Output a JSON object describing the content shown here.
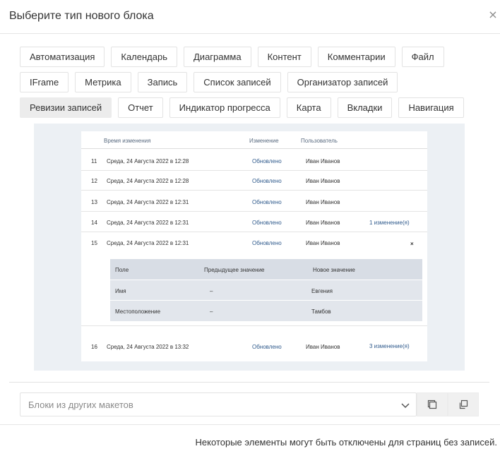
{
  "dialog": {
    "title": "Выберите тип нового блока",
    "close_glyph": "×"
  },
  "block_types": {
    "row1": [
      "Автоматизация",
      "Календарь",
      "Диаграмма",
      "Контент",
      "Комментарии",
      "Файл"
    ],
    "row2": [
      "IFrame",
      "Метрика",
      "Запись",
      "Список записей",
      "Организатор записей"
    ],
    "row3": [
      "Ревизии записей",
      "Отчет",
      "Индикатор прогресса",
      "Карта",
      "Вкладки",
      "Навигация"
    ],
    "selected": "Ревизии записей"
  },
  "preview": {
    "columns": {
      "time": "Время изменения",
      "change": "Изменение",
      "user": "Пользователь"
    },
    "rows": [
      {
        "num": "11",
        "date": "Среда, 24 Августа 2022 в 12:28",
        "change": "Обновлено",
        "user": "Иван Иванов",
        "link": ""
      },
      {
        "num": "12",
        "date": "Среда, 24 Августа 2022 в 12:28",
        "change": "Обновлено",
        "user": "Иван Иванов",
        "link": ""
      },
      {
        "num": "13",
        "date": "Среда, 24 Августа 2022 в 12:31",
        "change": "Обновлено",
        "user": "Иван Иванов",
        "link": ""
      },
      {
        "num": "14",
        "date": "Среда, 24 Августа 2022 в 12:31",
        "change": "Обновлено",
        "user": "Иван Иванов",
        "link": "1 изменение(я)"
      },
      {
        "num": "15",
        "date": "Среда, 24 Августа 2022 в 12:31",
        "change": "Обновлено",
        "user": "Иван Иванов",
        "link": ""
      },
      {
        "num": "16",
        "date": "Среда, 24 Августа 2022 в 13:32",
        "change": "Обновлено",
        "user": "Иван Иванов",
        "link": "3 изменение(я)"
      }
    ],
    "expanded_close": "×",
    "detail": {
      "columns": {
        "field": "Поле",
        "previous": "Предыдущее значение",
        "new": "Новое значение"
      },
      "rows": [
        {
          "field": "Имя",
          "previous": "–",
          "new": "Евгения"
        },
        {
          "field": "Местоположение",
          "previous": "–",
          "new": "Тамбов"
        }
      ]
    }
  },
  "other_layouts": {
    "placeholder": "Блоки из других макетов"
  },
  "footer": {
    "note": "Некоторые элементы могут быть отключены для страниц без записей."
  }
}
